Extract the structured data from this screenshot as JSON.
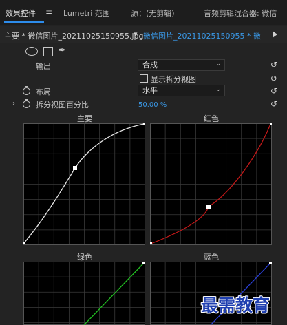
{
  "tabs": {
    "effect_controls": "效果控件",
    "menu_glyph": "≡",
    "lumetri_scope": "Lumetri 范围",
    "source": "源：(无剪辑)",
    "audio_mixer": "音频剪辑混合器: 微信"
  },
  "clip": {
    "master": "主要 * 微信图片_20211025150955.jpg",
    "arrow": "▾",
    "sequence": "微信图片_20211025150955 * 微"
  },
  "shapes": {
    "pen_glyph": "✒"
  },
  "rows": {
    "output_label": "输出",
    "output_value": "合成",
    "show_split_label": "显示拆分视图",
    "layout_label": "布局",
    "layout_value": "水平",
    "split_pct_label": "拆分视图百分比",
    "split_pct_value": "50.00 %",
    "reset_glyph": "↺",
    "chevron_glyph": "⌄",
    "expand_glyph": "›"
  },
  "curves": {
    "master_title": "主要",
    "red_title": "红色",
    "green_title": "绿色",
    "blue_title": "蓝色",
    "master_color": "#e6e6e6",
    "red_color": "#c01818",
    "green_color": "#22c022",
    "blue_color": "#2a3fd6"
  },
  "watermark": "最需教育"
}
